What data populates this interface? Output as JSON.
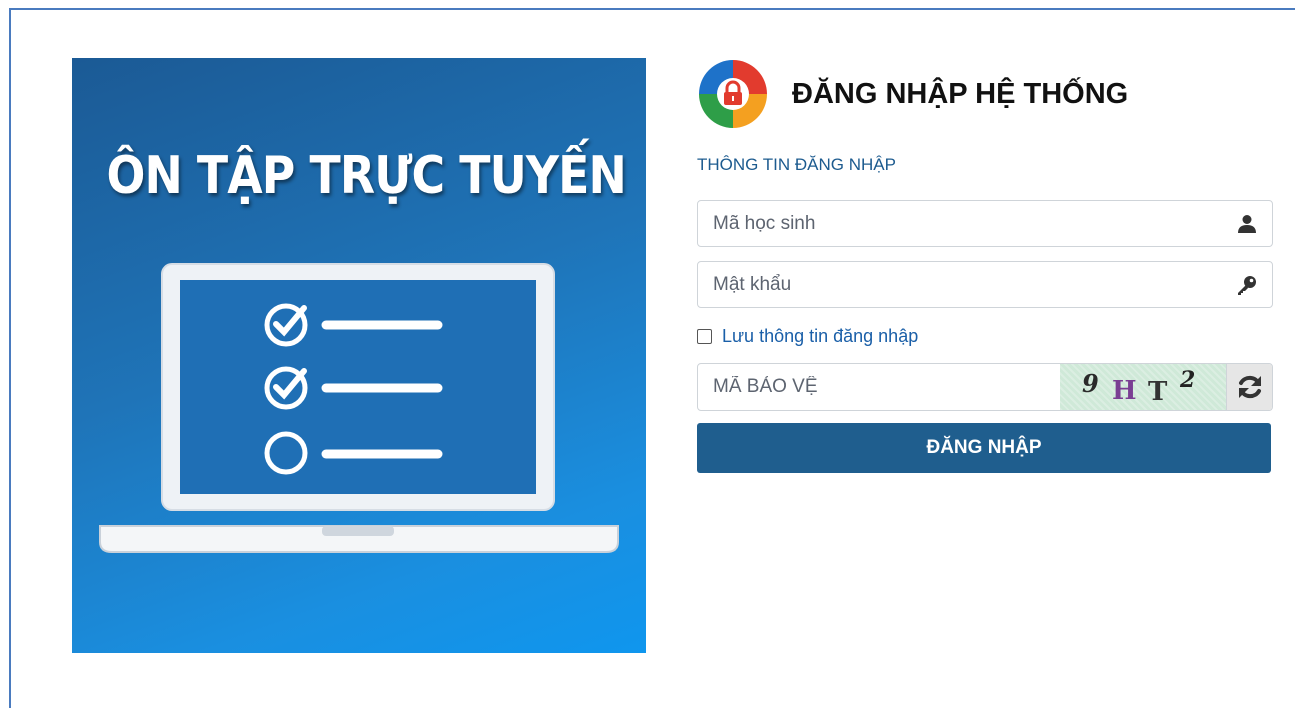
{
  "banner": {
    "title": "ÔN TẬP TRỰC TUYẾN",
    "icon": "laptop-checklist-illustration"
  },
  "header": {
    "logo_icon": "lock-shield-logo-icon",
    "title": "ĐĂNG NHẬP HỆ THỐNG"
  },
  "form": {
    "section_label": "THÔNG TIN ĐĂNG NHẬP",
    "student_id": {
      "placeholder": "Mã học sinh",
      "value": "",
      "icon": "user-icon"
    },
    "password": {
      "placeholder": "Mật khẩu",
      "value": "",
      "icon": "key-icon"
    },
    "remember": {
      "label": "Lưu thông tin đăng nhập",
      "checked": false
    },
    "captcha": {
      "placeholder": "MÃ BẢO VỆ",
      "value": "",
      "chars": [
        "9",
        "H",
        "T",
        "2"
      ],
      "refresh_icon": "refresh-icon"
    },
    "submit_label": "ĐĂNG NHẬP"
  },
  "colors": {
    "primary": "#1f5e8e",
    "link": "#1a5fa8",
    "banner_start": "#1b5a95",
    "banner_end": "#0f96ee",
    "captcha_bg": "#cfe9d8"
  }
}
